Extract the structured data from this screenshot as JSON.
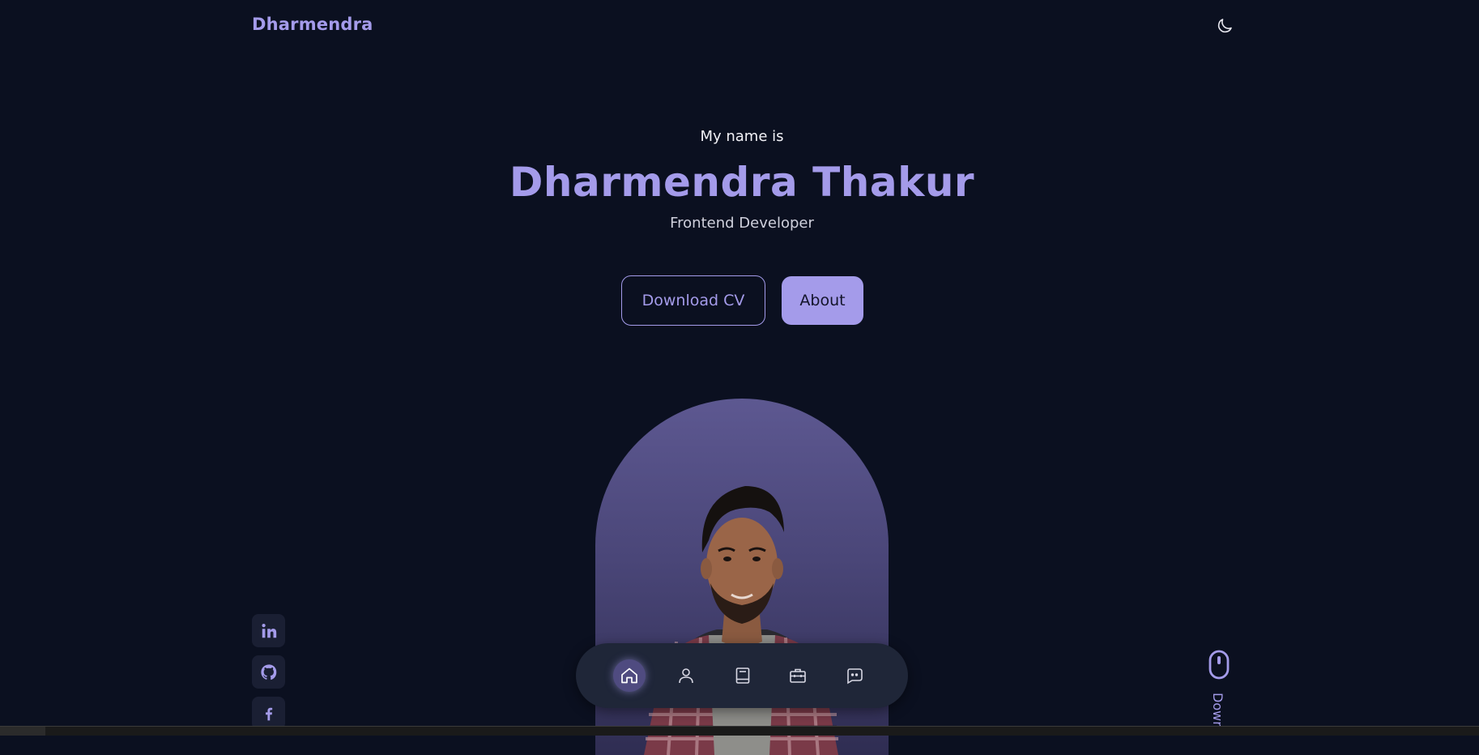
{
  "header": {
    "logo": "Dharmendra",
    "theme_icon": "moon-icon"
  },
  "hero": {
    "greeting": "My name is",
    "name": "Dharmendra Thakur",
    "role": "Frontend Developer",
    "download_cv_label": "Download CV",
    "about_label": "About"
  },
  "socials": [
    {
      "name": "LinkedIn",
      "icon": "linkedin-icon"
    },
    {
      "name": "GitHub",
      "icon": "github-icon"
    },
    {
      "name": "Facebook",
      "icon": "facebook-icon"
    }
  ],
  "nav": {
    "items": [
      {
        "icon": "home-icon",
        "active": true
      },
      {
        "icon": "user-icon",
        "active": false
      },
      {
        "icon": "book-icon",
        "active": false
      },
      {
        "icon": "briefcase-icon",
        "active": false
      },
      {
        "icon": "message-icon",
        "active": false
      }
    ]
  },
  "scroll": {
    "label": "Down",
    "icon": "mouse-icon"
  },
  "colors": {
    "background": "#0b1020",
    "accent": "#a49bea",
    "card": "#1a1f33",
    "nav_bg": "#1f2638"
  }
}
